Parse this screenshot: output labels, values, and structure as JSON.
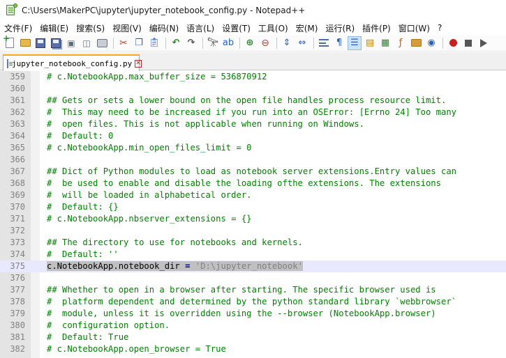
{
  "window": {
    "title": "C:\\Users\\MakerPC\\jupyter\\jupyter_notebook_config.py - Notepad++"
  },
  "menu": [
    "文件(F)",
    "编辑(E)",
    "搜索(S)",
    "视图(V)",
    "编码(N)",
    "语言(L)",
    "设置(T)",
    "工具(O)",
    "宏(M)",
    "运行(R)",
    "插件(P)",
    "窗口(W)",
    "?"
  ],
  "toolbar": {
    "icons": [
      "new-file-icon",
      "open-folder-icon",
      "save-icon",
      "save-all-icon",
      "close-icon",
      "close-all-icon",
      "print-icon",
      "cut-icon",
      "copy-icon",
      "paste-icon",
      "undo-icon",
      "redo-icon",
      "find-icon",
      "replace-icon",
      "zoom-in-icon",
      "zoom-out-icon",
      "sync-vertical-icon",
      "sync-horizontal-icon",
      "word-wrap-icon",
      "show-all-characters-icon",
      "indent-guide-icon",
      "language-udl-icon",
      "document-map-icon",
      "function-list-icon",
      "folder-as-workspace-icon",
      "monitoring-icon",
      "record-macro-icon",
      "stop-recording-icon",
      "play-macro-icon"
    ]
  },
  "tabs": [
    {
      "label": "jupyter_notebook_config.py",
      "active": true
    }
  ],
  "editor": {
    "current_line": 375,
    "lines": [
      {
        "n": "359",
        "text": "# c.NotebookApp.max_buffer_size = 536870912"
      },
      {
        "n": "360",
        "text": ""
      },
      {
        "n": "361",
        "text": "## Gets or sets a lower bound on the open file handles process resource limit."
      },
      {
        "n": "362",
        "text": "#  This may need to be increased if you run into an OSError: [Errno 24] Too many"
      },
      {
        "n": "363",
        "text": "#  open files. This is not applicable when running on Windows."
      },
      {
        "n": "364",
        "text": "#  Default: 0"
      },
      {
        "n": "365",
        "text": "# c.NotebookApp.min_open_files_limit = 0"
      },
      {
        "n": "366",
        "text": ""
      },
      {
        "n": "367",
        "text": "## Dict of Python modules to load as notebook server extensions.Entry values can"
      },
      {
        "n": "368",
        "text": "#  be used to enable and disable the loading ofthe extensions. The extensions"
      },
      {
        "n": "369",
        "text": "#  will be loaded in alphabetical order."
      },
      {
        "n": "370",
        "text": "#  Default: {}"
      },
      {
        "n": "371",
        "text": "# c.NotebookApp.nbserver_extensions = {}"
      },
      {
        "n": "372",
        "text": ""
      },
      {
        "n": "373",
        "text": "## The directory to use for notebooks and kernels."
      },
      {
        "n": "374",
        "text": "#  Default: ''"
      },
      {
        "n": "375",
        "text": ""
      },
      {
        "n": "376",
        "text": ""
      },
      {
        "n": "377",
        "text": "## Whether to open in a browser after starting. The specific browser used is"
      },
      {
        "n": "378",
        "text": "#  platform dependent and determined by the python standard library `webbrowser`"
      },
      {
        "n": "379",
        "text": "#  module, unless it is overridden using the --browser (NotebookApp.browser)"
      },
      {
        "n": "380",
        "text": "#  configuration option."
      },
      {
        "n": "381",
        "text": "#  Default: True"
      },
      {
        "n": "382",
        "text": "# c.NotebookApp.open_browser = True"
      }
    ],
    "code_line_375": {
      "lhs": "c.NotebookApp.notebook_dir",
      "op": " = ",
      "value": "'D:\\jupyter_notebook'"
    }
  }
}
